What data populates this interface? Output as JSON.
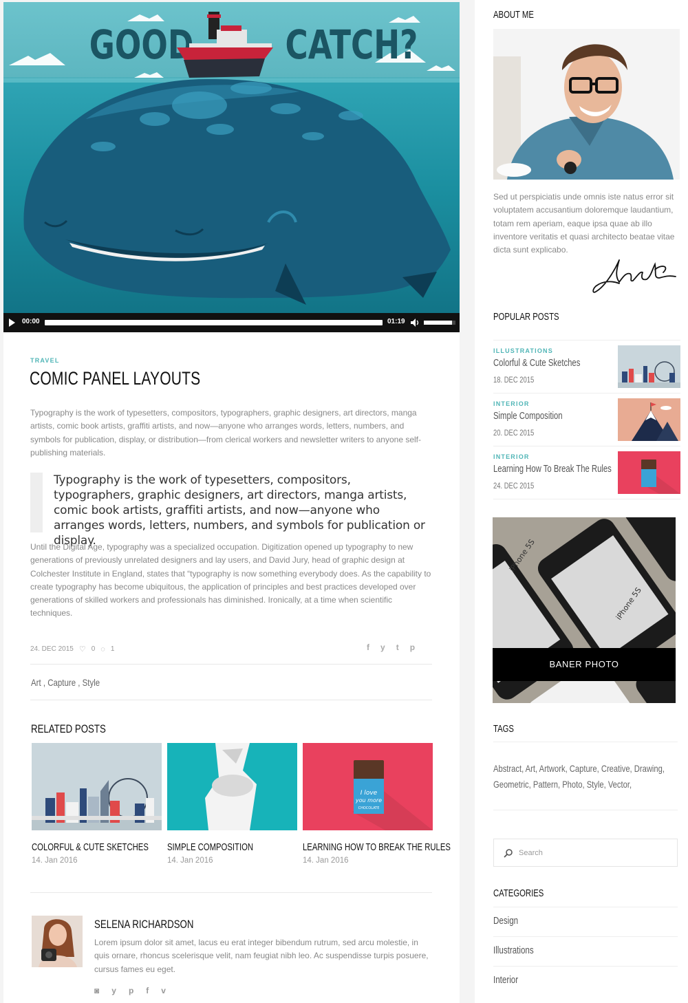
{
  "player": {
    "time_current": "00:00",
    "time_total": "01:19",
    "volume": 0.9
  },
  "post": {
    "category": "TRAVEL",
    "title": "COMIC PANEL LAYOUTS",
    "intro": "Typography is the work of typesetters, compositors, typographers, graphic designers, art directors, manga artists, comic book artists, graffiti artists, and now—anyone who arranges words, letters, numbers, and symbols for publication, display, or distribution—from clerical workers and newsletter writers to anyone self-publishing materials.",
    "quote": "Typography is the work of typesetters, compositors, typographers, graphic designers, art directors, manga artists, comic book artists, graffiti artists, and now—anyone who arranges words, letters, numbers, and symbols for publication or display.",
    "detail": "Until the Digital Age, typography was a specialized occupation. Digitization opened up typography to new generations of previously unrelated designers and lay users, and David Jury, head of graphic design at Colchester Institute in England, states that “typography is now something everybody does. As the capability to create typography has become ubiquitous, the application of principles and best practices developed over generations of skilled workers and professionals has diminished. Ironically, at a time when scientific techniques.",
    "date": "24. DEC 2015",
    "likes": "0",
    "comments": "1",
    "share_icons": [
      "facebook-icon",
      "twitter-icon",
      "tumblr-icon",
      "pinterest-icon"
    ],
    "share_glyphs": [
      "f",
      "y",
      "t",
      "p"
    ],
    "tags": "Art ,  Capture ,  Style"
  },
  "related": {
    "heading": "RELATED POSTS",
    "items": [
      {
        "title": "COLORFUL & CUTE SKETCHES",
        "date": "14. Jan 2016"
      },
      {
        "title": "SIMPLE COMPOSITION",
        "date": "14. Jan 2016"
      },
      {
        "title": "LEARNING HOW TO BREAK THE RULES",
        "date": "14. Jan 2016"
      }
    ]
  },
  "author": {
    "name": "SELENA RICHARDSON",
    "bio": "Lorem ipsum dolor sit amet, lacus eu erat integer bibendum rutrum, sed arcu molestie, in quis ornare, rhoncus scelerisque velit, nam feugiat nibh leo. Ac suspendisse turpis posuere, cursus fames eu eget.",
    "social_glyphs": [
      "◙",
      "y",
      "p",
      "f",
      "v"
    ]
  },
  "sidebar": {
    "about_heading": "ABOUT ME",
    "about_text": "Sed ut perspiciatis unde omnis iste natus error sit voluptatem accusantium doloremque laudantium, totam rem aperiam, eaque ipsa quae ab illo inventore veritatis et quasi architecto beatae vitae dicta sunt explicabo.",
    "popular_heading": "POPULAR POSTS",
    "popular": [
      {
        "category": "ILLUSTRATIONS",
        "title": "Colorful & Cute Sketches",
        "date": "18. DEC 2015"
      },
      {
        "category": "INTERIOR",
        "title": "Simple Composition",
        "date": "20. DEC 2015"
      },
      {
        "category": "INTERIOR",
        "title": "Learning How To Break The Rules",
        "date": "24. DEC 2015"
      }
    ],
    "banner_label": "BANER PHOTO",
    "tags_heading": "TAGS",
    "tags": "Abstract, Art, Artwork, Capture, Creative, Drawing, Geometric, Pattern, Photo, Style, Vector,",
    "search_placeholder": "Search",
    "categories_heading": "CATEGORIES",
    "categories": [
      "Design",
      "Illustrations",
      "Interior"
    ]
  },
  "hero": {
    "text_left": "GOOD",
    "text_right": "CATCH?"
  },
  "colors": {
    "accent": "#4fb5b6",
    "pink": "#e9415e",
    "teal": "#17b3b9",
    "peach": "#e8ab93"
  }
}
